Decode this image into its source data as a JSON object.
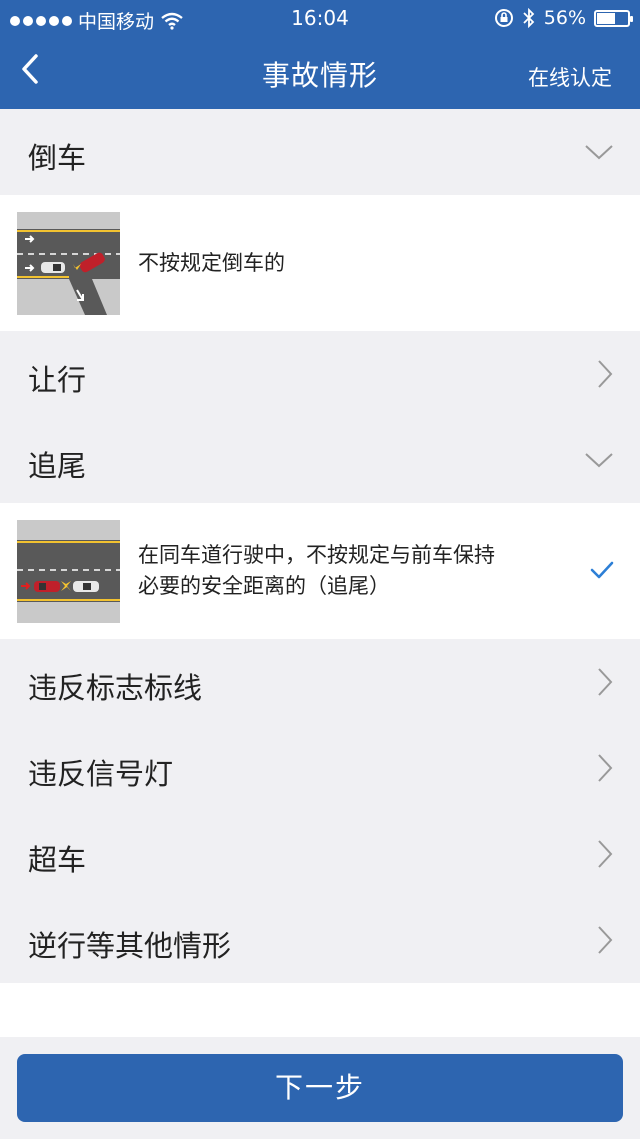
{
  "status_bar": {
    "carrier": "中国移动",
    "time": "16:04",
    "battery": "56%",
    "battery_level": 0.56,
    "icons": [
      "signal-dots-icon",
      "wifi-icon",
      "rotation-lock-icon",
      "bluetooth-icon",
      "battery-icon"
    ]
  },
  "nav": {
    "title": "事故情形",
    "action": "在线认定",
    "back_icon": "back-chevron-icon"
  },
  "categories": [
    {
      "label": "倒车",
      "state": "expanded"
    },
    {
      "label": "让行",
      "state": "collapsed"
    },
    {
      "label": "追尾",
      "state": "expanded"
    },
    {
      "label": "违反标志标线",
      "state": "collapsed"
    },
    {
      "label": "违反信号灯",
      "state": "collapsed"
    },
    {
      "label": "超车",
      "state": "collapsed"
    },
    {
      "label": "逆行等其他情形",
      "state": "collapsed"
    }
  ],
  "items": [
    {
      "text": "不按规定倒车的",
      "selected": false
    },
    {
      "text_line1": "在同车道行驶中，不按规定与前车保持",
      "text_line2": "必要的安全距离的（追尾）",
      "selected": true
    }
  ],
  "footer": {
    "button": "下一步"
  },
  "colors": {
    "accent": "#2d65b0",
    "background": "#f0f0f3",
    "check": "#2d7fd6",
    "chevron": "#999999"
  }
}
